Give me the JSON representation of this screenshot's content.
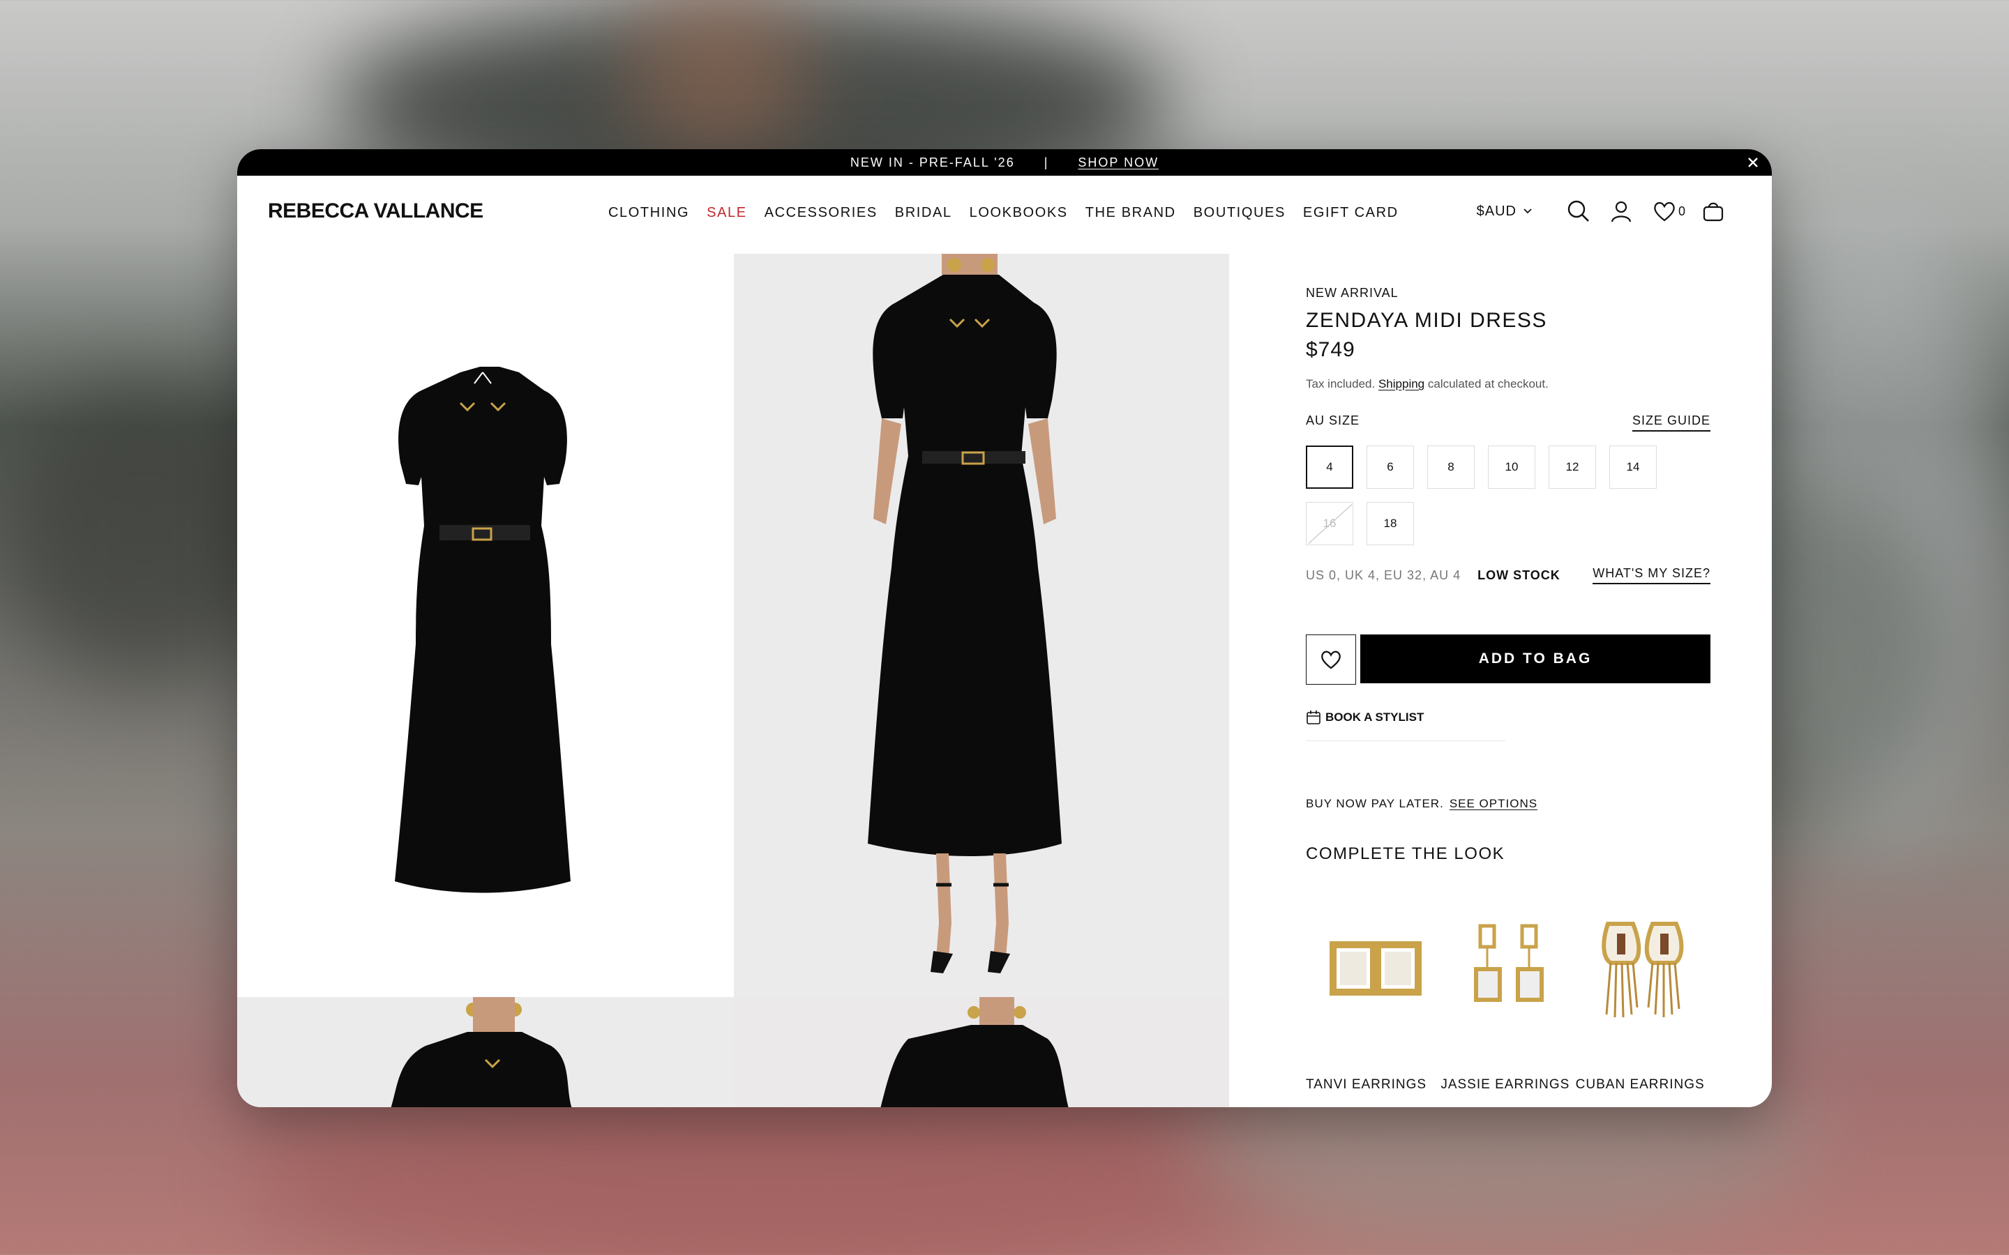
{
  "announcement": {
    "text": "NEW IN - PRE-FALL '26",
    "separator": "|",
    "link": "SHOP NOW"
  },
  "header": {
    "logo": "REBECCA VALLANCE",
    "nav": [
      "CLOTHING",
      "SALE",
      "ACCESSORIES",
      "BRIDAL",
      "LOOKBOOKS",
      "THE BRAND",
      "BOUTIQUES",
      "EGIFT CARD"
    ],
    "currency": "$AUD",
    "wishlist_count": "0"
  },
  "product": {
    "tag": "NEW ARRIVAL",
    "title": "ZENDAYA MIDI DRESS",
    "price": "$749",
    "tax_prefix": "Tax included.",
    "tax_link": "Shipping",
    "tax_suffix": "calculated at checkout.",
    "size_label": "AU SIZE",
    "size_guide": "SIZE GUIDE",
    "sizes": [
      "4",
      "6",
      "8",
      "10",
      "12",
      "14",
      "16",
      "18"
    ],
    "selected_size": "4",
    "unavailable_size": "16",
    "size_conversion": "US 0, UK 4, EU 32, AU 4",
    "stock": "LOW STOCK",
    "whats_my_size": "WHAT'S MY SIZE?",
    "add_to_bag": "ADD TO BAG",
    "book_stylist": "BOOK A STYLIST",
    "bnpl_text": "BUY NOW PAY LATER.",
    "bnpl_link": "SEE OPTIONS"
  },
  "complete_the_look": {
    "title": "COMPLETE THE LOOK",
    "items": [
      "TANVI EARRINGS",
      "JASSIE EARRINGS",
      "CUBAN EARRINGS"
    ]
  },
  "colors": {
    "sale": "#c1272d",
    "black": "#000000",
    "gold": "#c9a24a"
  }
}
